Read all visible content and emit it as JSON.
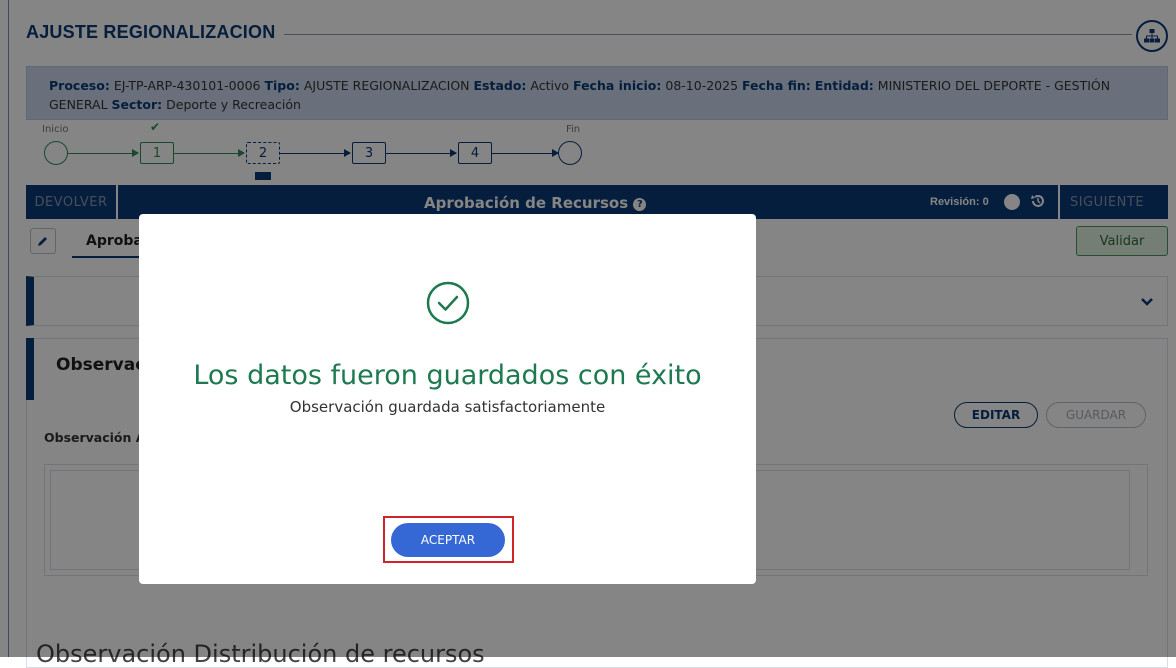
{
  "header": {
    "title": "AJUSTE REGIONALIZACION",
    "org_icon": "sitemap-icon"
  },
  "process_info": {
    "proceso_label": "Proceso:",
    "proceso_value": "EJ-TP-ARP-430101-0006",
    "tipo_label": "Tipo:",
    "tipo_value": "AJUSTE REGIONALIZACION",
    "estado_label": "Estado:",
    "estado_value": "Activo",
    "fecha_inicio_label": "Fecha inicio:",
    "fecha_inicio_value": "08-10-2025",
    "fecha_fin_label": "Fecha fin:",
    "entidad_label": "Entidad:",
    "entidad_value": "MINISTERIO DEL DEPORTE - GESTIÓN GENERAL",
    "sector_label": "Sector:",
    "sector_value": "Deporte y Recreación"
  },
  "stepper": {
    "start_label": "Inicio",
    "end_label": "Fin",
    "steps": [
      "1",
      "2",
      "3",
      "4"
    ],
    "completed_mark": "✔",
    "colors": {
      "done": "#2e8b57",
      "current": "#0b3a75",
      "pending": "#0b3a75"
    }
  },
  "toolbar": {
    "devolver": "DEVOLVER",
    "title": "Aprobación de Recursos",
    "help_icon": "question-circle-icon",
    "revision": "Revisión: 0",
    "siguiente": "SIGUIENTE",
    "bg_color": "#0b3a75"
  },
  "tabs": {
    "edit_icon": "pencil-icon",
    "active_tab": "Aproba"
  },
  "validar_label": "Validar",
  "observations": {
    "title": "Observac",
    "field_label": "Observación A",
    "edit_label": "EDITAR",
    "save_label": "GUARDAR",
    "bottom_heading": "Observación Distribución de recursos"
  },
  "modal": {
    "icon": "check-circle-icon",
    "title": "Los datos fueron guardados con éxito",
    "message": "Observación guardada satisfactoriamente",
    "accept_label": "ACEPTAR",
    "title_color": "#1d7a50",
    "button_color": "#3568d4",
    "highlight_color": "#d0242b"
  }
}
